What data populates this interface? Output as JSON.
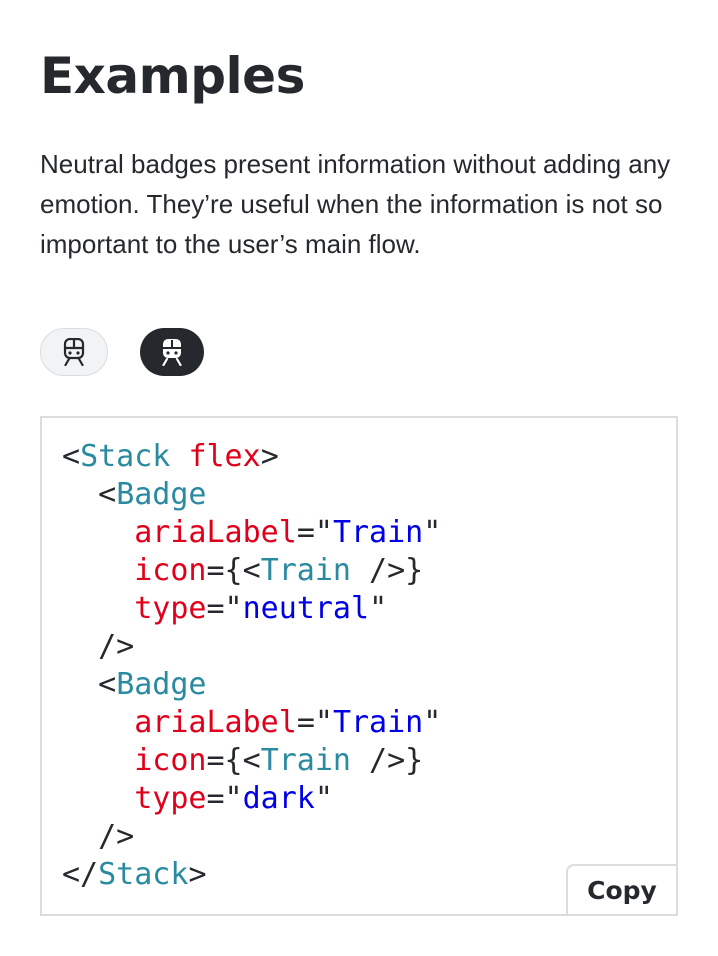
{
  "heading": "Examples",
  "description": "Neutral badges present information without adding any emotion. They’re useful when the information is not so important to the user’s main flow.",
  "badges": [
    {
      "type": "neutral",
      "icon": "train-icon",
      "aria_label": "Train"
    },
    {
      "type": "dark",
      "icon": "train-icon",
      "aria_label": "Train"
    }
  ],
  "code": {
    "lines": [
      [
        [
          "punc",
          "<"
        ],
        [
          "tag",
          "Stack"
        ],
        [
          "punc",
          " "
        ],
        [
          "attr",
          "flex"
        ],
        [
          "punc",
          ">"
        ]
      ],
      [
        [
          "punc",
          "  <"
        ],
        [
          "tag",
          "Badge"
        ]
      ],
      [
        [
          "punc",
          "    "
        ],
        [
          "attr",
          "ariaLabel"
        ],
        [
          "punc",
          "=\""
        ],
        [
          "str",
          "Train"
        ],
        [
          "punc",
          "\""
        ]
      ],
      [
        [
          "punc",
          "    "
        ],
        [
          "attr",
          "icon"
        ],
        [
          "punc",
          "={<"
        ],
        [
          "tag",
          "Train"
        ],
        [
          "punc",
          " />}"
        ]
      ],
      [
        [
          "punc",
          "    "
        ],
        [
          "attr",
          "type"
        ],
        [
          "punc",
          "=\""
        ],
        [
          "str",
          "neutral"
        ],
        [
          "punc",
          "\""
        ]
      ],
      [
        [
          "punc",
          "  />"
        ]
      ],
      [
        [
          "punc",
          "  <"
        ],
        [
          "tag",
          "Badge"
        ]
      ],
      [
        [
          "punc",
          "    "
        ],
        [
          "attr",
          "ariaLabel"
        ],
        [
          "punc",
          "=\""
        ],
        [
          "str",
          "Train"
        ],
        [
          "punc",
          "\""
        ]
      ],
      [
        [
          "punc",
          "    "
        ],
        [
          "attr",
          "icon"
        ],
        [
          "punc",
          "={<"
        ],
        [
          "tag",
          "Train"
        ],
        [
          "punc",
          " />}"
        ]
      ],
      [
        [
          "punc",
          "    "
        ],
        [
          "attr",
          "type"
        ],
        [
          "punc",
          "=\""
        ],
        [
          "str",
          "dark"
        ],
        [
          "punc",
          "\""
        ]
      ],
      [
        [
          "punc",
          "  />"
        ]
      ],
      [
        [
          "punc",
          "</"
        ],
        [
          "tag",
          "Stack"
        ],
        [
          "punc",
          ">"
        ]
      ]
    ]
  },
  "copy_label": "Copy",
  "colors": {
    "text": "#25292e",
    "tag": "#2a8aa0",
    "attr": "#e0001b",
    "string": "#0000e6",
    "badge_neutral_bg": "#f1f3f5",
    "badge_dark_bg": "#25292e"
  }
}
